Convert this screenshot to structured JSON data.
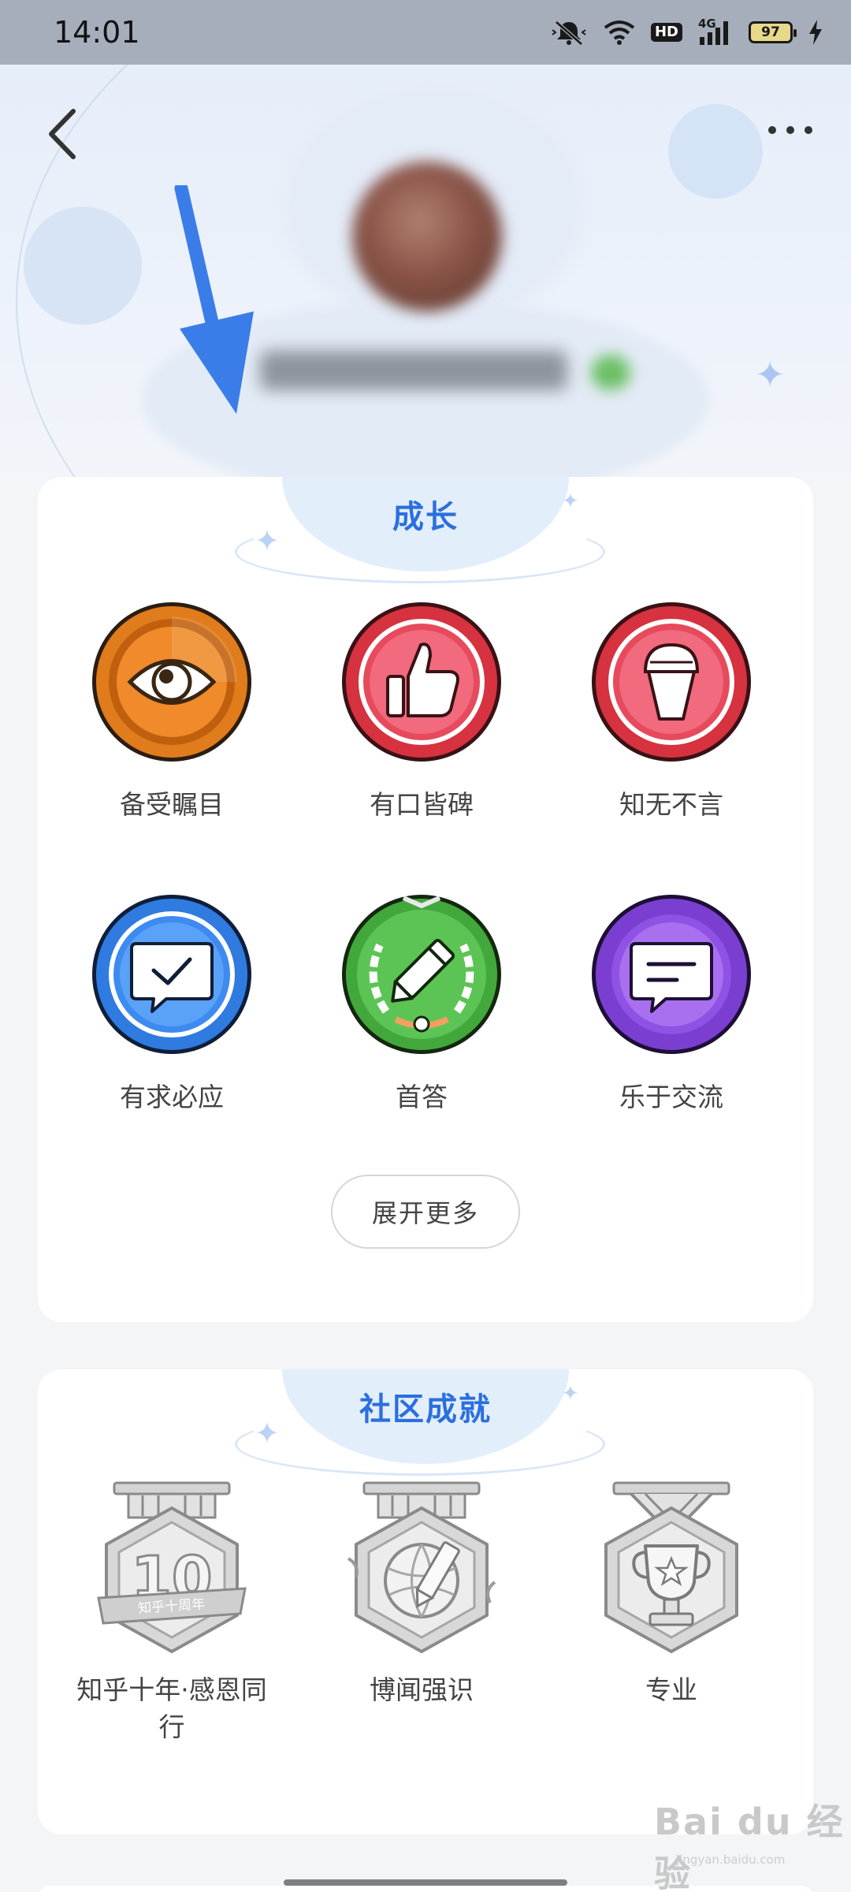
{
  "status_bar": {
    "time": "14:01",
    "hd_label": "HD",
    "network_label": "4G",
    "battery_level": "97",
    "icons": [
      "mute-bell-icon",
      "wifi-icon",
      "hd-icon",
      "signal-icon",
      "battery-icon",
      "charging-icon"
    ]
  },
  "header": {
    "back_icon": "chevron-left-icon",
    "more_icon": "more-dots-icon"
  },
  "growth": {
    "title": "成长",
    "badges": [
      {
        "label": "备受瞩目",
        "icon": "eye-icon",
        "color": "#e07c1c"
      },
      {
        "label": "有口皆碑",
        "icon": "thumbs-up-icon",
        "color": "#e24a5a"
      },
      {
        "label": "知无不言",
        "icon": "microphone-icon",
        "color": "#e24a5a"
      },
      {
        "label": "有求必应",
        "icon": "chat-check-icon",
        "color": "#2f7be0"
      },
      {
        "label": "首答",
        "icon": "pencil-icon",
        "color": "#42a83c"
      },
      {
        "label": "乐于交流",
        "icon": "chat-lines-icon",
        "color": "#8a4fd6"
      }
    ],
    "expand_label": "展开更多"
  },
  "community": {
    "title": "社区成就",
    "badges": [
      {
        "label": "知乎十年·感恩同行",
        "icon": "ten-years-icon",
        "emblem_number": "10",
        "ribbon_text": "知乎十周年"
      },
      {
        "label": "博闻强识",
        "icon": "globe-pencil-icon"
      },
      {
        "label": "专业",
        "icon": "trophy-icon"
      }
    ]
  },
  "watermark": {
    "text": "Bai du 经验",
    "sub": "jingyan.baidu.com"
  },
  "colors": {
    "accent": "#2a6fde",
    "background": "#f4f5f7",
    "card": "#ffffff",
    "arrow": "#3a7de8"
  }
}
